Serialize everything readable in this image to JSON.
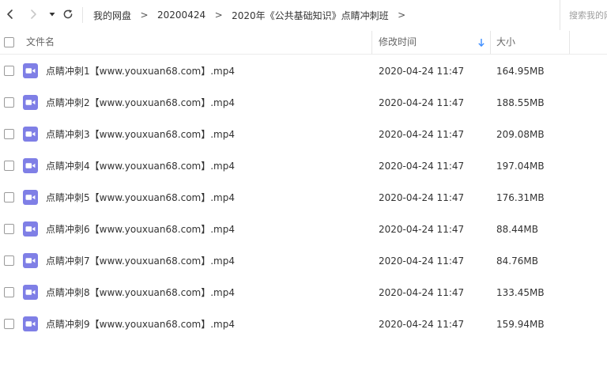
{
  "nav": {
    "breadcrumb": [
      {
        "label": "我的网盘"
      },
      {
        "label": "20200424"
      },
      {
        "label": "2020年《公共基础知识》点睛冲刺班"
      }
    ],
    "separator": ">",
    "search_placeholder": "搜索我的网盘文件"
  },
  "columns": {
    "name": "文件名",
    "modified": "修改时间",
    "size": "大小"
  },
  "files": [
    {
      "name": "点睛冲刺1【www.youxuan68.com】.mp4",
      "modified": "2020-04-24 11:47",
      "size": "164.95MB"
    },
    {
      "name": "点睛冲刺2【www.youxuan68.com】.mp4",
      "modified": "2020-04-24 11:47",
      "size": "188.55MB"
    },
    {
      "name": "点睛冲刺3【www.youxuan68.com】.mp4",
      "modified": "2020-04-24 11:47",
      "size": "209.08MB"
    },
    {
      "name": "点睛冲刺4【www.youxuan68.com】.mp4",
      "modified": "2020-04-24 11:47",
      "size": "197.04MB"
    },
    {
      "name": "点睛冲刺5【www.youxuan68.com】.mp4",
      "modified": "2020-04-24 11:47",
      "size": "176.31MB"
    },
    {
      "name": "点睛冲刺6【www.youxuan68.com】.mp4",
      "modified": "2020-04-24 11:47",
      "size": "88.44MB"
    },
    {
      "name": "点睛冲刺7【www.youxuan68.com】.mp4",
      "modified": "2020-04-24 11:47",
      "size": "84.76MB"
    },
    {
      "name": "点睛冲刺8【www.youxuan68.com】.mp4",
      "modified": "2020-04-24 11:47",
      "size": "133.45MB"
    },
    {
      "name": "点睛冲刺9【www.youxuan68.com】.mp4",
      "modified": "2020-04-24 11:47",
      "size": "159.94MB"
    }
  ],
  "icons": {
    "back": "chevron-left-icon",
    "forward": "chevron-right-icon",
    "history": "caret-down-icon",
    "refresh": "refresh-icon",
    "sort": "sort-descending-icon",
    "file": "video-file-icon"
  },
  "colors": {
    "accent": "#3b8cff",
    "video_icon": "#7f7fe6",
    "forward_disabled": "#c8c8c8"
  }
}
